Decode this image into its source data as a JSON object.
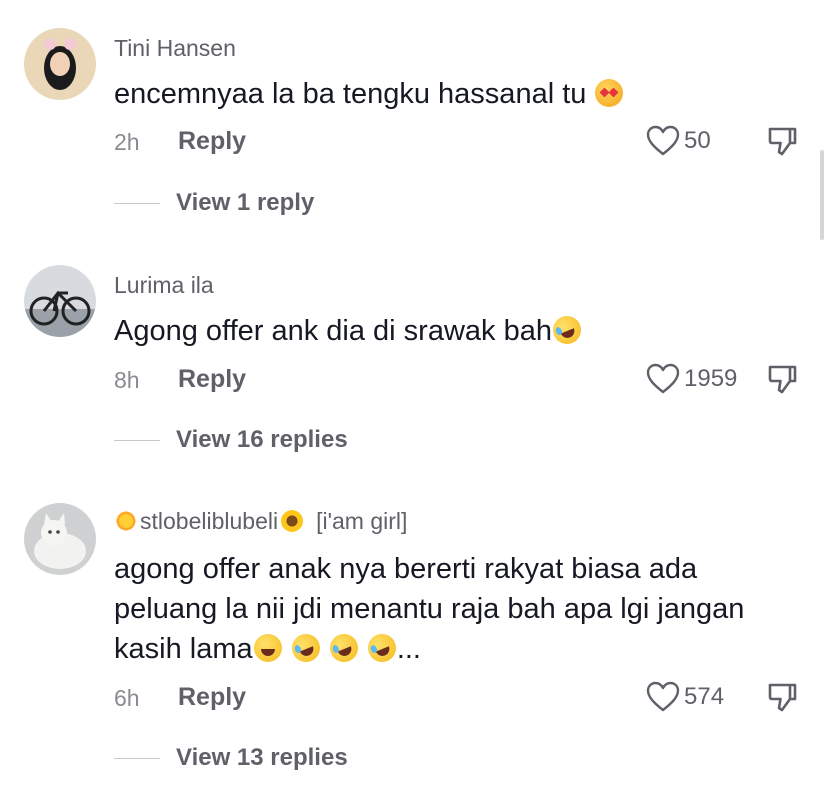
{
  "comments": [
    {
      "username": "Tini Hansen",
      "text": "encemnyaa la ba tengku hassanal tu",
      "time": "2h",
      "reply_label": "Reply",
      "likes": "50",
      "view_replies": "View 1 reply",
      "avatar_icon": "person-avatar"
    },
    {
      "username": "Lurima ila",
      "text": "Agong offer ank dia di srawak bah",
      "time": "8h",
      "reply_label": "Reply",
      "likes": "1959",
      "view_replies": "View 16 replies",
      "avatar_icon": "bicycle-avatar"
    },
    {
      "username": "stlobeliblubeli",
      "username_tag": "[i'am girl]",
      "text": "agong offer anak nya bererti rakyat biasa ada peluang la nii jdi menantu raja bah apa lgi jangan kasih lama",
      "text_suffix": "...",
      "time": "6h",
      "reply_label": "Reply",
      "likes": "574",
      "view_replies": "View 13 replies",
      "avatar_icon": "cat-avatar"
    }
  ],
  "colors": {
    "text_primary": "#161823",
    "text_secondary": "#5f6068",
    "text_muted": "#8a8b91",
    "background": "#ffffff"
  }
}
